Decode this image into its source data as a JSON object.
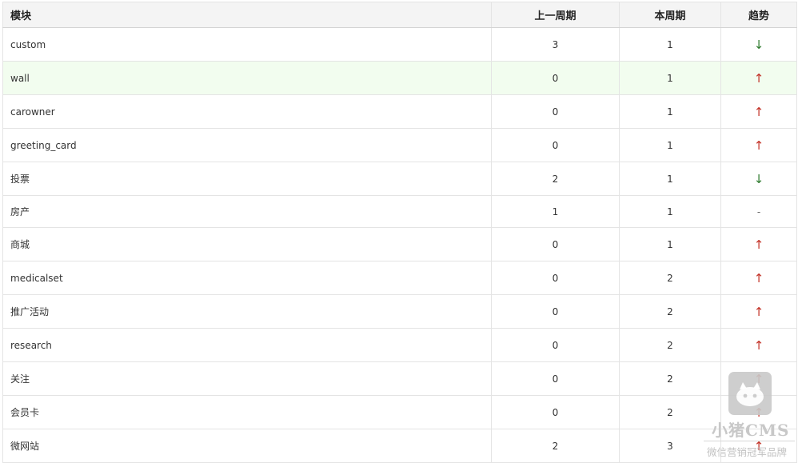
{
  "table": {
    "headers": {
      "module": "模块",
      "prev": "上一周期",
      "curr": "本周期",
      "trend": "趋势"
    },
    "rows": [
      {
        "module": "custom",
        "prev": "3",
        "curr": "1",
        "trend": "↓",
        "trend_dir": "down"
      },
      {
        "module": "wall",
        "prev": "0",
        "curr": "1",
        "trend": "↑",
        "trend_dir": "up"
      },
      {
        "module": "carowner",
        "prev": "0",
        "curr": "1",
        "trend": "↑",
        "trend_dir": "up"
      },
      {
        "module": "greeting_card",
        "prev": "0",
        "curr": "1",
        "trend": "↑",
        "trend_dir": "up"
      },
      {
        "module": "投票",
        "prev": "2",
        "curr": "1",
        "trend": "↓",
        "trend_dir": "down"
      },
      {
        "module": "房产",
        "prev": "1",
        "curr": "1",
        "trend": "-",
        "trend_dir": "flat"
      },
      {
        "module": "商城",
        "prev": "0",
        "curr": "1",
        "trend": "↑",
        "trend_dir": "up"
      },
      {
        "module": "medicalset",
        "prev": "0",
        "curr": "2",
        "trend": "↑",
        "trend_dir": "up"
      },
      {
        "module": "推广活动",
        "prev": "0",
        "curr": "2",
        "trend": "↑",
        "trend_dir": "up"
      },
      {
        "module": "research",
        "prev": "0",
        "curr": "2",
        "trend": "↑",
        "trend_dir": "up"
      },
      {
        "module": "关注",
        "prev": "0",
        "curr": "2",
        "trend": "↑",
        "trend_dir": "up"
      },
      {
        "module": "会员卡",
        "prev": "0",
        "curr": "2",
        "trend": "↑",
        "trend_dir": "up"
      },
      {
        "module": "微网站",
        "prev": "2",
        "curr": "3",
        "trend": "↑",
        "trend_dir": "up"
      }
    ]
  },
  "colors": {
    "up": "#c33227",
    "down": "#2d7a2d",
    "row_hover": "#f2fdef",
    "header_bg": "#f4f4f4"
  },
  "watermark": {
    "brand": "小猪CMS",
    "slogan": "微信营销冠军品牌",
    "icon": "pig-logo-icon"
  }
}
